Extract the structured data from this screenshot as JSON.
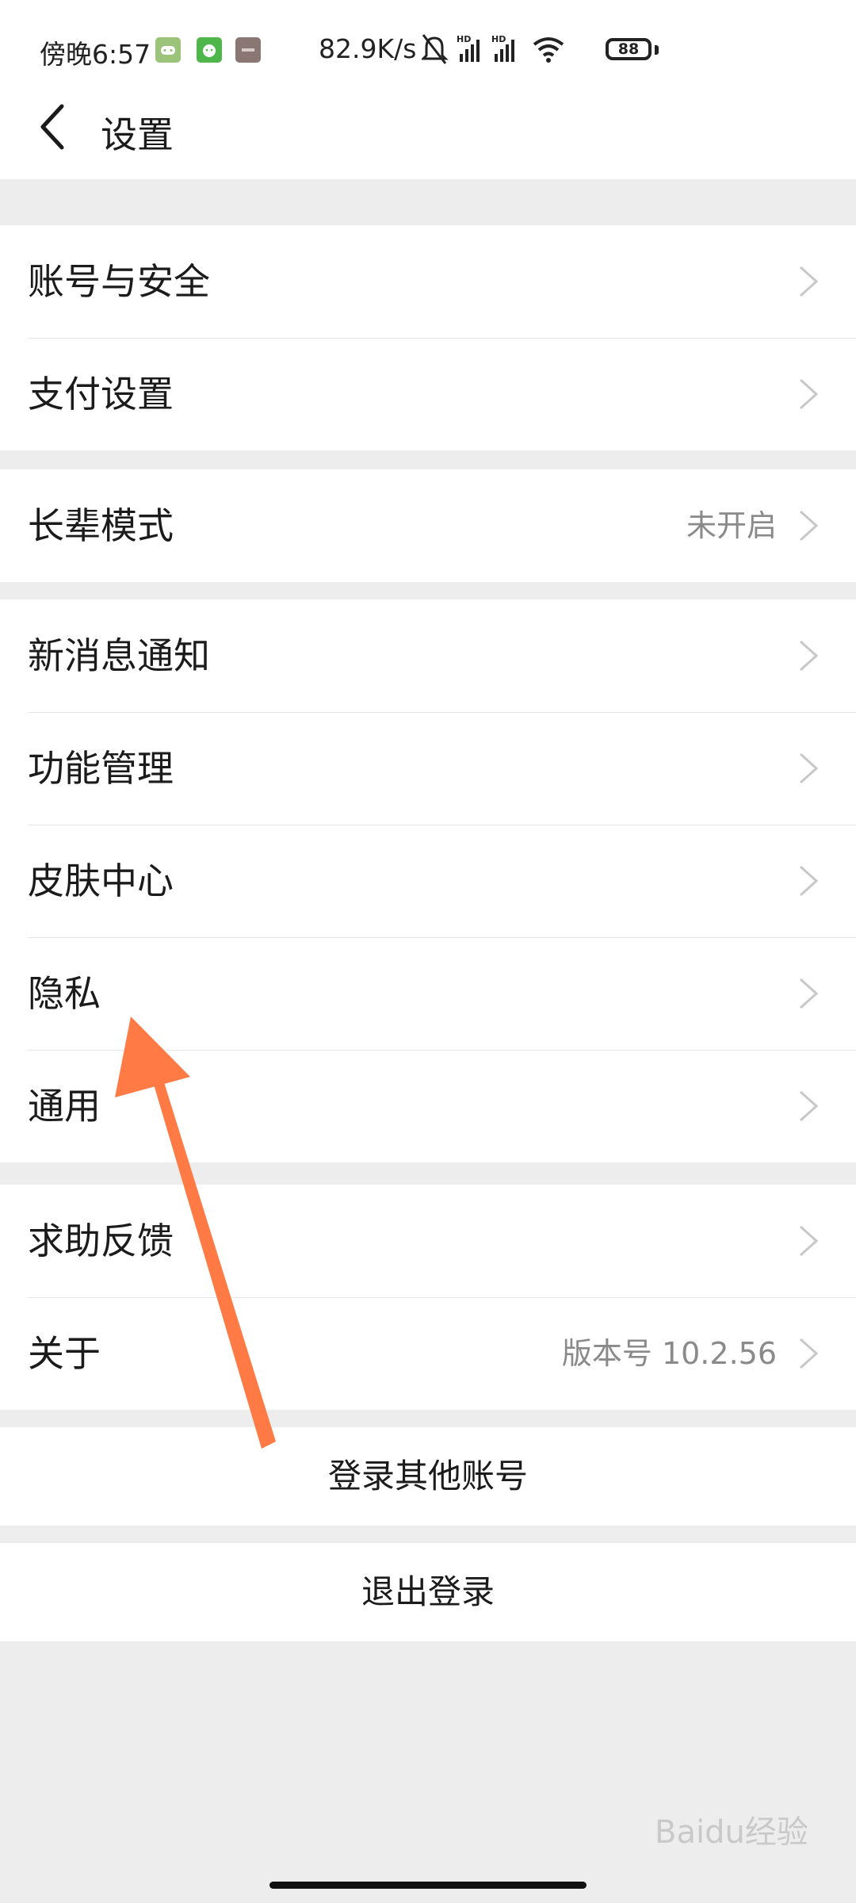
{
  "status_bar": {
    "time": "傍晚6:57",
    "network_speed": "82.9K/s",
    "battery_level": "88",
    "signal_label": "HD",
    "icons": [
      "game-app-icon",
      "android-app-icon",
      "photo-app-icon",
      "mute-icon",
      "signal-icon",
      "signal-icon",
      "wifi-icon",
      "battery-icon"
    ]
  },
  "header": {
    "title": "设置",
    "back_icon": "chevron-left-icon"
  },
  "groups": [
    {
      "rows": [
        {
          "label": "账号与安全",
          "value": ""
        },
        {
          "label": "支付设置",
          "value": ""
        }
      ]
    },
    {
      "rows": [
        {
          "label": "长辈模式",
          "value": "未开启"
        }
      ]
    },
    {
      "rows": [
        {
          "label": "新消息通知",
          "value": ""
        },
        {
          "label": "功能管理",
          "value": ""
        },
        {
          "label": "皮肤中心",
          "value": ""
        },
        {
          "label": "隐私",
          "value": ""
        },
        {
          "label": "通用",
          "value": ""
        }
      ]
    },
    {
      "rows": [
        {
          "label": "求助反馈",
          "value": ""
        },
        {
          "label": "关于",
          "value": "版本号 10.2.56"
        }
      ]
    }
  ],
  "actions": {
    "switch_account": "登录其他账号",
    "logout": "退出登录"
  },
  "colors": {
    "background": "#ededed",
    "card": "#ffffff",
    "annotation_arrow": "#ff7a45",
    "secondary_text": "#8a8a8a"
  },
  "watermark": "Baidu经验"
}
